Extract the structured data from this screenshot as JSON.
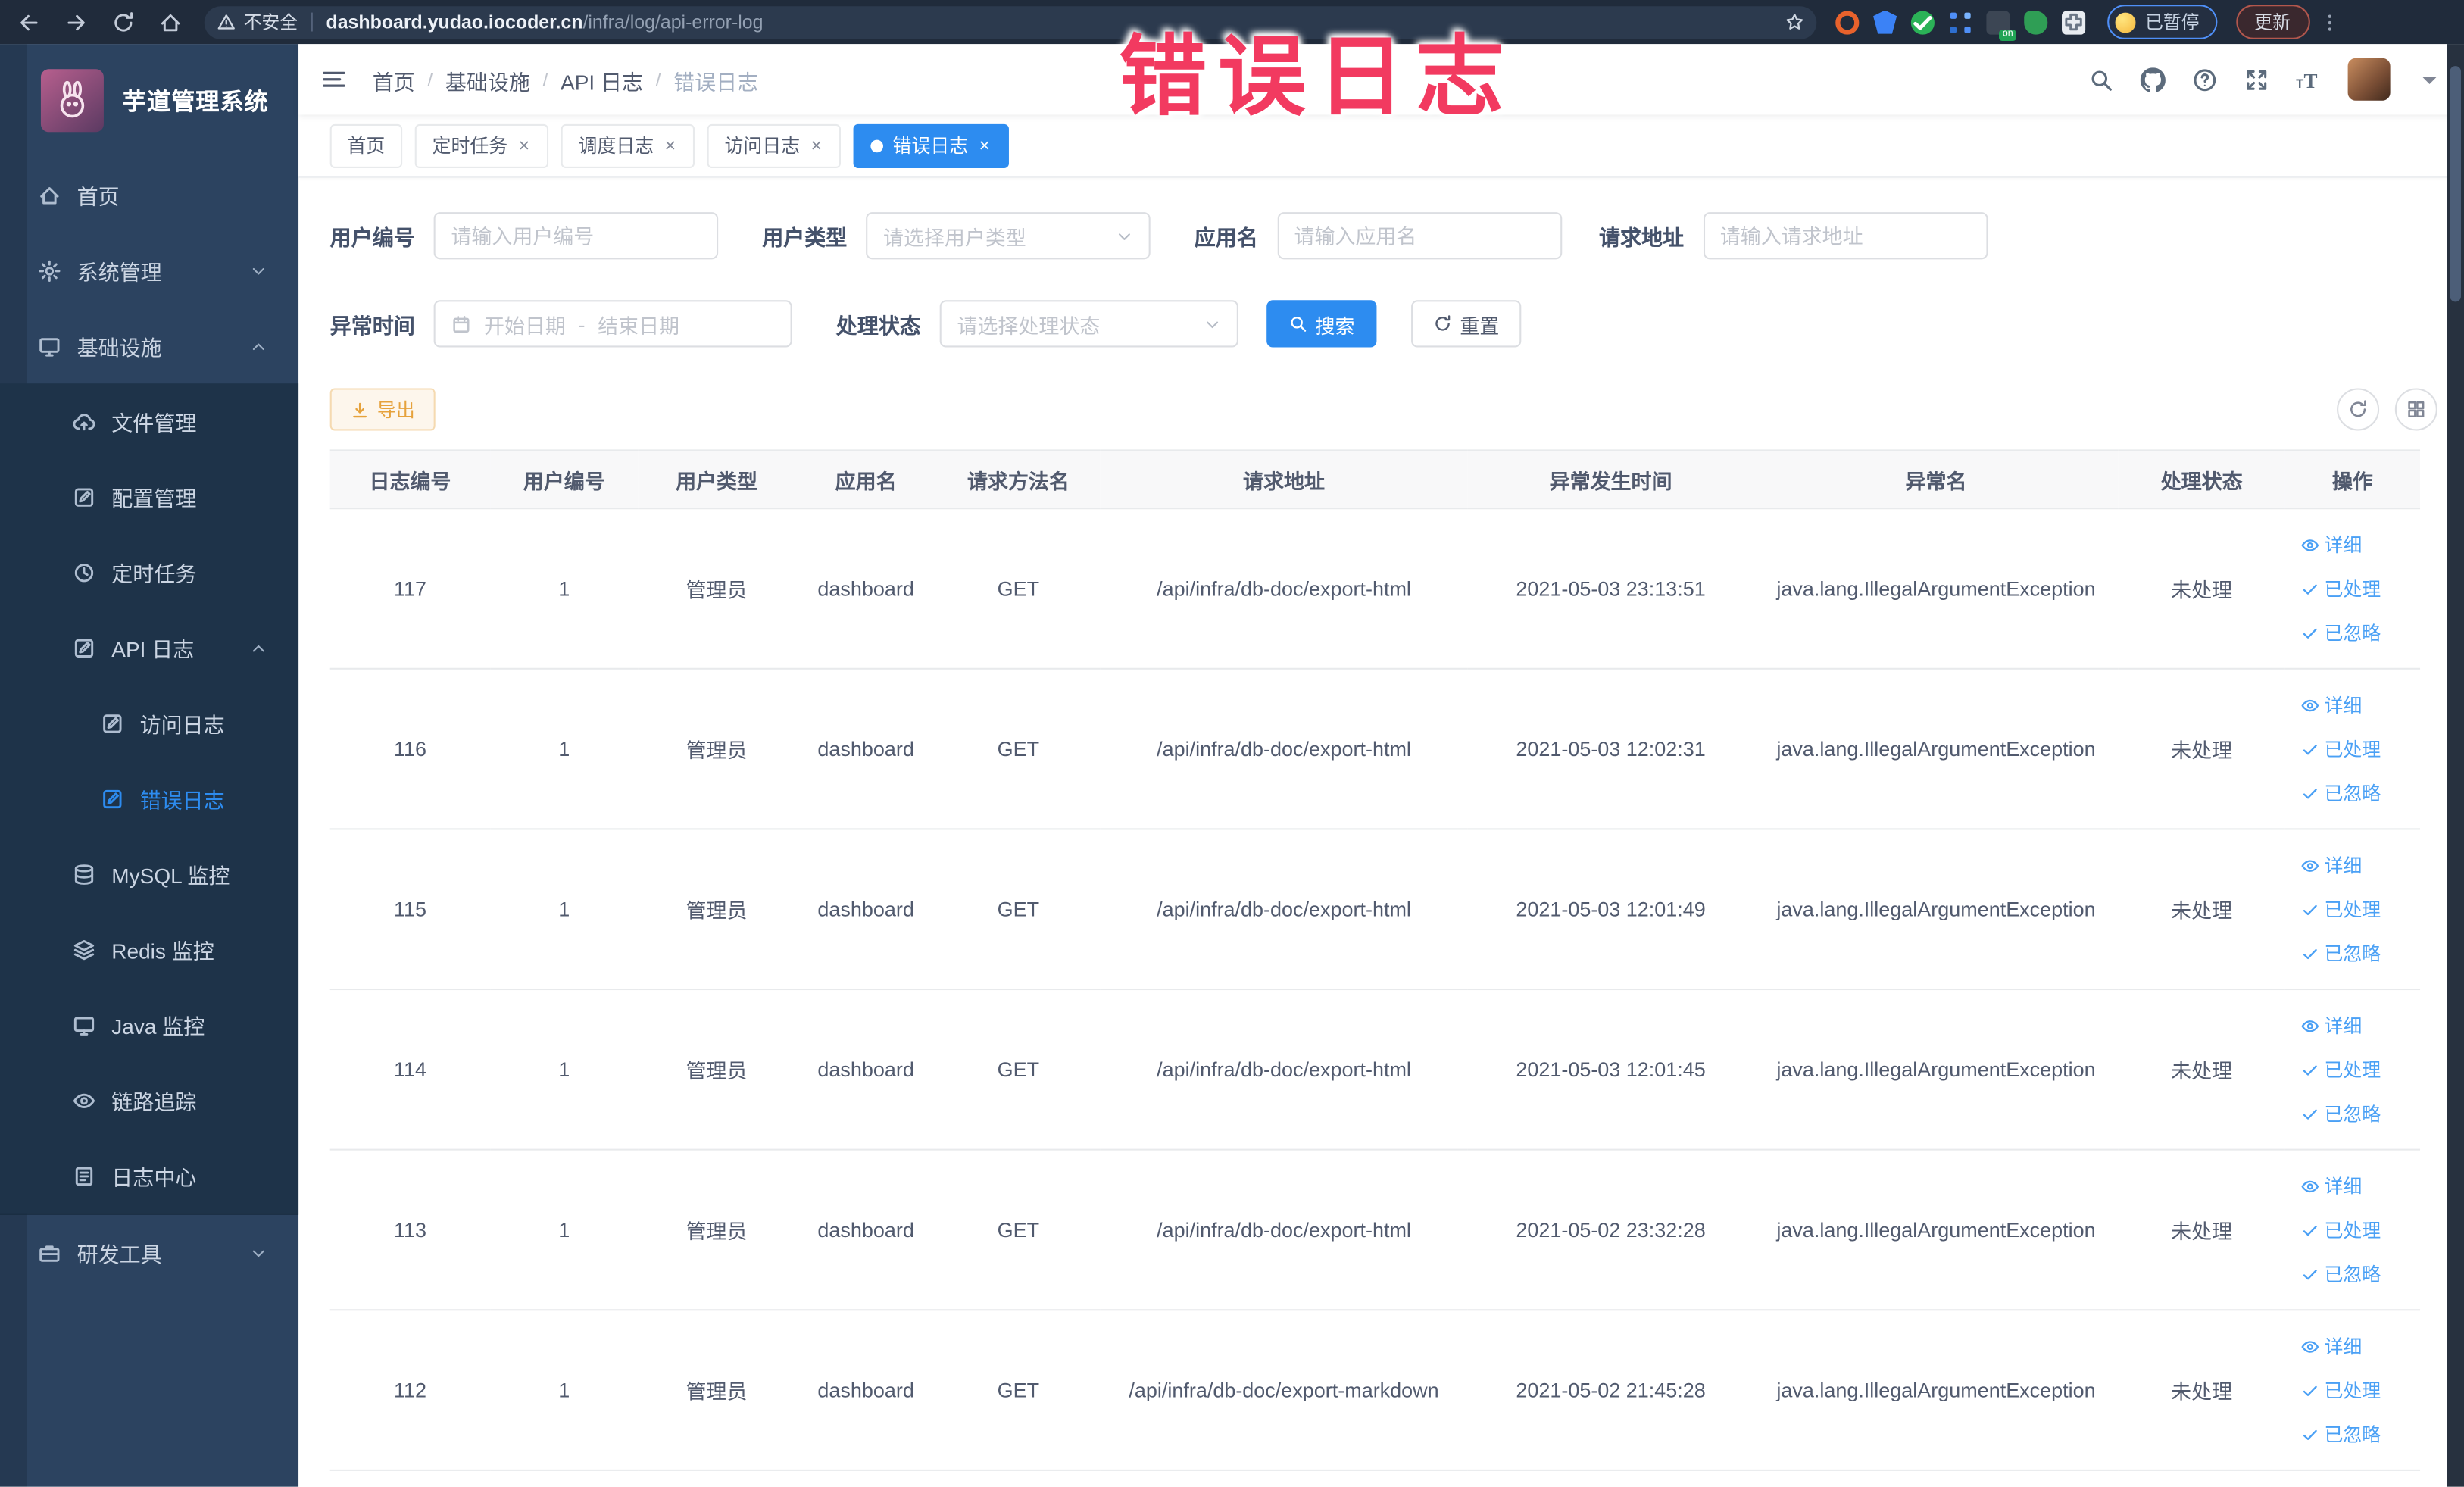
{
  "browser": {
    "security_label": "不安全",
    "url_host": "dashboard.yudao.iocoder.cn",
    "url_path": "/infra/log/api-error-log",
    "extension_icons": [
      "orange-ring",
      "blue-shield",
      "green-check",
      "blue-grid",
      "green-on-badge",
      "green-leaf",
      "white-puzzle"
    ],
    "paused_badge": "已暂停",
    "update_button": "更新"
  },
  "overlay_title": "错误日志",
  "sidebar": {
    "logo_title": "芋道管理系统",
    "menu": [
      {
        "label": "首页",
        "icon": "home",
        "level": 1,
        "group": "top"
      },
      {
        "label": "系统管理",
        "icon": "gear",
        "level": 1,
        "arrow": "down",
        "group": "top"
      },
      {
        "label": "基础设施",
        "icon": "monitor",
        "level": 1,
        "arrow": "up",
        "group": "top"
      },
      {
        "label": "文件管理",
        "icon": "cloud-upload",
        "level": 2,
        "group": "sub"
      },
      {
        "label": "配置管理",
        "icon": "edit-square",
        "level": 2,
        "group": "sub"
      },
      {
        "label": "定时任务",
        "icon": "clock-history",
        "level": 2,
        "group": "sub"
      },
      {
        "label": "API 日志",
        "icon": "edit-square",
        "level": 2,
        "arrow": "up",
        "group": "sub"
      },
      {
        "label": "访问日志",
        "icon": "edit-square",
        "level": 3,
        "group": "sub"
      },
      {
        "label": "错误日志",
        "icon": "edit-square",
        "level": 3,
        "active": true,
        "group": "sub"
      },
      {
        "label": "MySQL 监控",
        "icon": "database",
        "level": 2,
        "group": "sub"
      },
      {
        "label": "Redis 监控",
        "icon": "layers",
        "level": 2,
        "group": "sub"
      },
      {
        "label": "Java 监控",
        "icon": "monitor",
        "level": 2,
        "group": "sub"
      },
      {
        "label": "链路追踪",
        "icon": "eye",
        "level": 2,
        "group": "sub"
      },
      {
        "label": "日志中心",
        "icon": "log-document",
        "level": 2,
        "group": "sub"
      },
      {
        "label": "研发工具",
        "icon": "toolbox",
        "level": 1,
        "arrow": "down",
        "group": "bottom"
      }
    ]
  },
  "header": {
    "breadcrumb": [
      "首页",
      "基础设施",
      "API 日志",
      "错误日志"
    ]
  },
  "tabs": [
    {
      "label": "首页",
      "closable": false,
      "active": false
    },
    {
      "label": "定时任务",
      "closable": true,
      "active": false
    },
    {
      "label": "调度日志",
      "closable": true,
      "active": false
    },
    {
      "label": "访问日志",
      "closable": true,
      "active": false
    },
    {
      "label": "错误日志",
      "closable": true,
      "active": true
    }
  ],
  "filters": {
    "user_id": {
      "label": "用户编号",
      "placeholder": "请输入用户编号"
    },
    "user_type": {
      "label": "用户类型",
      "placeholder": "请选择用户类型"
    },
    "app_name": {
      "label": "应用名",
      "placeholder": "请输入应用名"
    },
    "request_url": {
      "label": "请求地址",
      "placeholder": "请输入请求地址"
    },
    "exception_time": {
      "label": "异常时间",
      "start_placeholder": "开始日期",
      "separator": "-",
      "end_placeholder": "结束日期"
    },
    "process_status": {
      "label": "处理状态",
      "placeholder": "请选择处理状态"
    },
    "search_button": "搜索",
    "reset_button": "重置"
  },
  "toolbar": {
    "export_button": "导出"
  },
  "table": {
    "columns": [
      "日志编号",
      "用户编号",
      "用户类型",
      "应用名",
      "请求方法名",
      "请求地址",
      "异常发生时间",
      "异常名",
      "处理状态",
      "操作"
    ],
    "actions": [
      "详细",
      "已处理",
      "已忽略"
    ],
    "rows": [
      {
        "id": "117",
        "user_id": "1",
        "user_type": "管理员",
        "app": "dashboard",
        "method": "GET",
        "url": "/api/infra/db-doc/export-html",
        "time": "2021-05-03 23:13:51",
        "exception": "java.lang.IllegalArgumentException",
        "status": "未处理"
      },
      {
        "id": "116",
        "user_id": "1",
        "user_type": "管理员",
        "app": "dashboard",
        "method": "GET",
        "url": "/api/infra/db-doc/export-html",
        "time": "2021-05-03 12:02:31",
        "exception": "java.lang.IllegalArgumentException",
        "status": "未处理"
      },
      {
        "id": "115",
        "user_id": "1",
        "user_type": "管理员",
        "app": "dashboard",
        "method": "GET",
        "url": "/api/infra/db-doc/export-html",
        "time": "2021-05-03 12:01:49",
        "exception": "java.lang.IllegalArgumentException",
        "status": "未处理"
      },
      {
        "id": "114",
        "user_id": "1",
        "user_type": "管理员",
        "app": "dashboard",
        "method": "GET",
        "url": "/api/infra/db-doc/export-html",
        "time": "2021-05-03 12:01:45",
        "exception": "java.lang.IllegalArgumentException",
        "status": "未处理"
      },
      {
        "id": "113",
        "user_id": "1",
        "user_type": "管理员",
        "app": "dashboard",
        "method": "GET",
        "url": "/api/infra/db-doc/export-html",
        "time": "2021-05-02 23:32:28",
        "exception": "java.lang.IllegalArgumentException",
        "status": "未处理"
      },
      {
        "id": "112",
        "user_id": "1",
        "user_type": "管理员",
        "app": "dashboard",
        "method": "GET",
        "url": "/api/infra/db-doc/export-markdown",
        "time": "2021-05-02 21:45:28",
        "exception": "java.lang.IllegalArgumentException",
        "status": "未处理"
      }
    ]
  },
  "colors": {
    "accent": "#2d8cf0",
    "warning": "#e6a23c",
    "overlay_pink": "#f23a60",
    "sidebar_bg": "#2c4360",
    "submenu_bg": "#1e3349"
  }
}
